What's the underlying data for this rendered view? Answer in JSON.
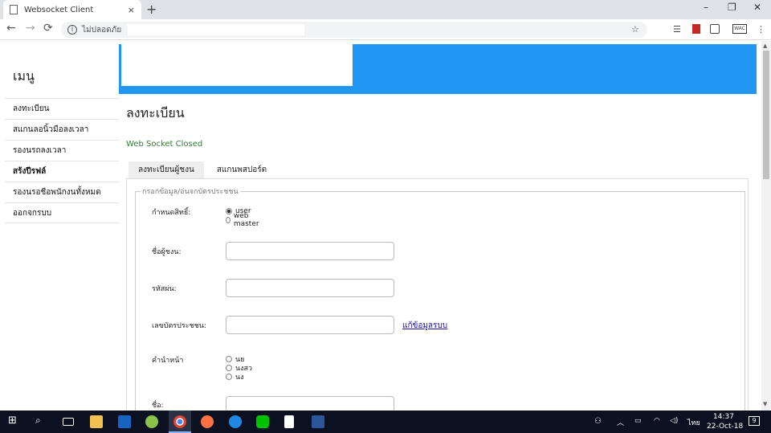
{
  "browser": {
    "tab_title": "Websocket Client",
    "tab_close": "×",
    "new_tab": "+",
    "window_min": "–",
    "window_max": "❐",
    "window_close": "✕",
    "back": "←",
    "forward": "→",
    "reload": "⟳",
    "security_label": "ไม่ปลอดภัย",
    "bookmark_star": "☆",
    "menu_dots": "⋮"
  },
  "sidebar": {
    "heading": "เมนู",
    "items": [
      {
        "label": "ลงทะเบียน"
      },
      {
        "label": "สแกนลอนิ้วมือลงเวลา"
      },
      {
        "label": "รองนรถลงเวลา"
      },
      {
        "label": "สร้งปีรฟล์"
      },
      {
        "label": "รองนรอชือพนักงนทั้งหมด"
      },
      {
        "label": "ออกจกรบบ"
      }
    ]
  },
  "main": {
    "title": "ลงทะเบียน",
    "status": "Web Socket Closed",
    "tabs": [
      {
        "label": "ลงทะเบียนผู้ชงน"
      },
      {
        "label": "สแกนพสปอร์ต"
      }
    ],
    "fieldset_legend": "กรอกข้อมูล/อ่นจกบัตรประชชน",
    "fields": {
      "role_label": "กำหนดสิทธิ์:",
      "role_options": [
        "user",
        "web master"
      ],
      "username_label": "ชื่อผู้ชงน:",
      "password_label": "รหัสผ่น:",
      "id_label": "เลขบัตรประชชน:",
      "id_link": "แก้ข้อมูลรบบ",
      "prefix_label": "คำนำหน้า",
      "prefix_options": [
        "นย",
        "นงสว",
        "นง"
      ],
      "name_label": "ชื่อ:"
    }
  },
  "taskbar": {
    "time": "14:37",
    "date": "22-Oct-18",
    "lang": "ไทย",
    "notifications": "9"
  },
  "colors": {
    "banner": "#2196f3",
    "status": "#2e7d32",
    "taskbar": "#0b1120"
  }
}
